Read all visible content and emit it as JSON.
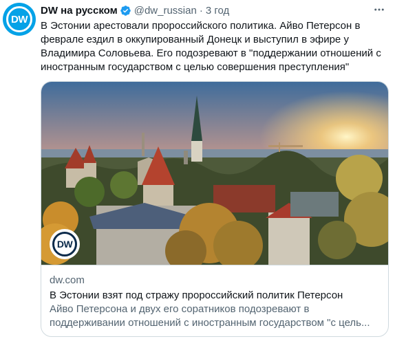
{
  "account": {
    "avatar_text": "DW",
    "display_name": "DW на русском",
    "handle": "@dw_russian",
    "separator": "·",
    "timestamp": "3 год",
    "verified_icon": "verified-badge-icon",
    "avatar_color": "#05a2e7"
  },
  "tweet": {
    "text": "В Эстонии арестовали пророссийского политика. Айво Петерсон в феврале ездил в оккупированный Донецк и выступил в эфире у Владимира Соловьева. Его подозревают в \"поддержании отношений с иностранным государством с целью совершения преступления\""
  },
  "card": {
    "badge_text": "DW",
    "domain": "dw.com",
    "title": "В Эстонии взят под стражу пророссийский политик Петерсон",
    "description": "Айво Петерсона и двух его соратников подозревают в поддерживании отношений с иностранным государством \"с цель..."
  },
  "colors": {
    "verified": "#1d9bf0",
    "secondary_text": "#536471",
    "border": "#cfd9de"
  }
}
